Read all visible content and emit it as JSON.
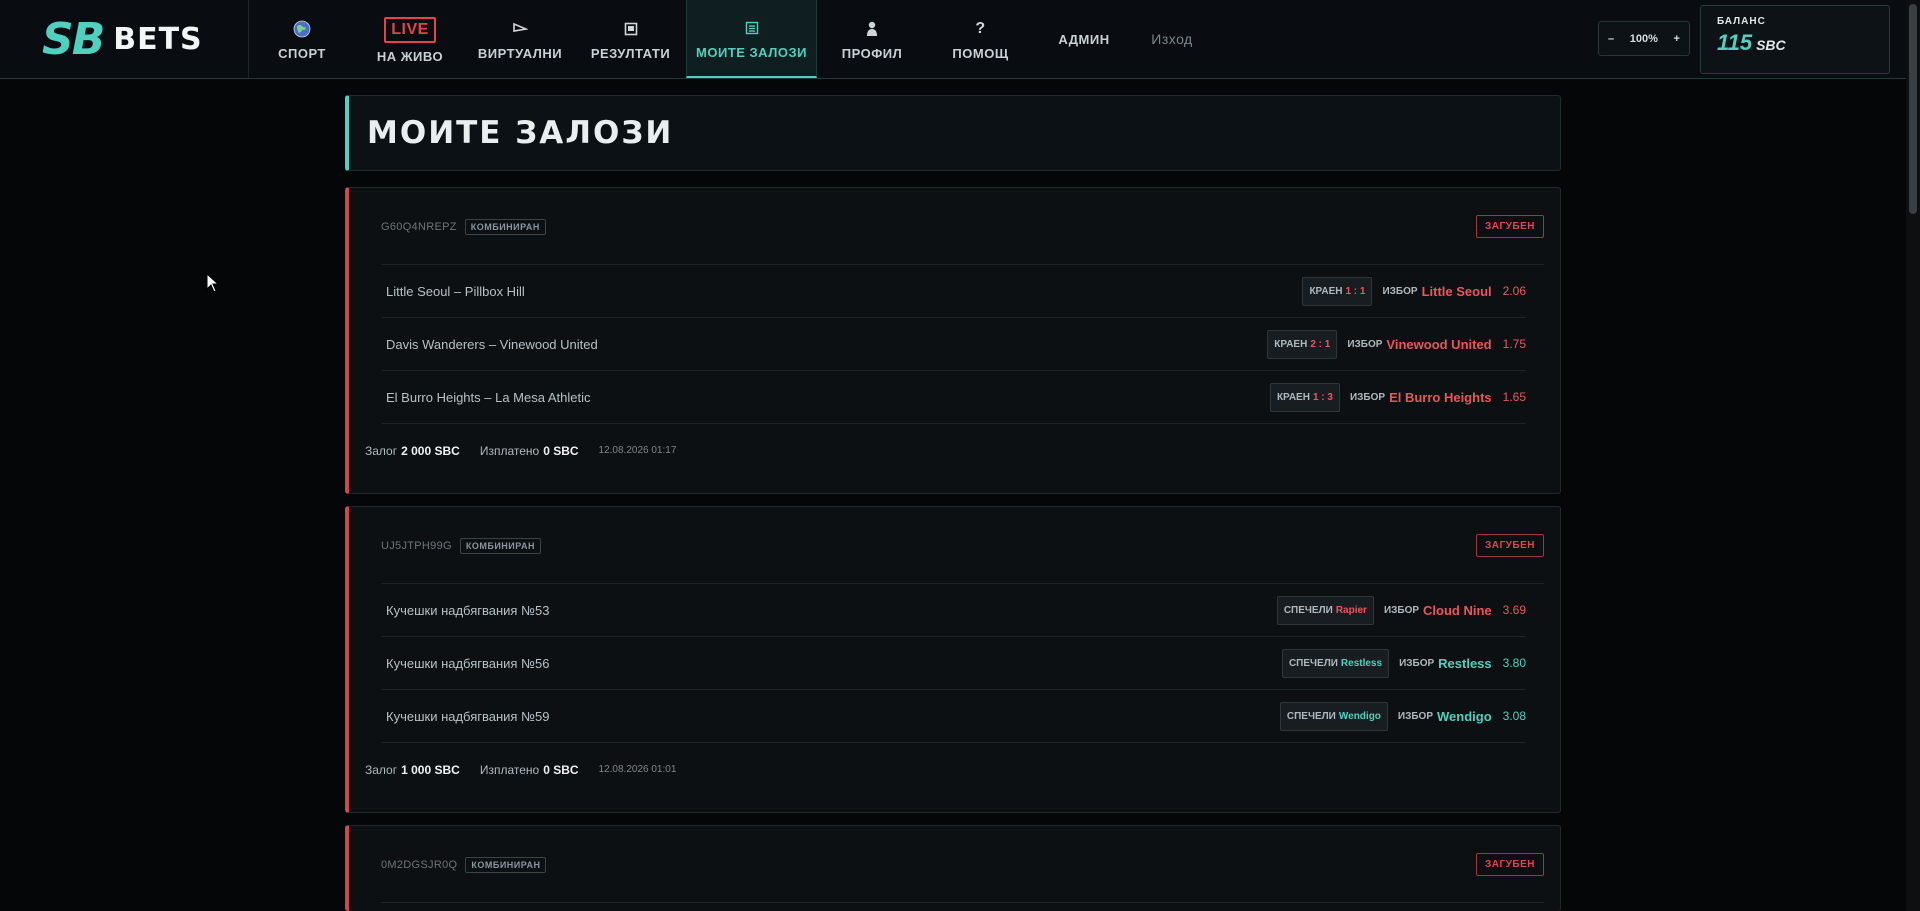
{
  "brand": {
    "sb": "SB",
    "bets": "BETS"
  },
  "nav": {
    "sport": {
      "label": "СПОРТ",
      "icon": "globe-icon"
    },
    "live": {
      "badge": "LIVE",
      "label": "НА ЖИВО"
    },
    "virtual": {
      "label": "ВИРТУАЛНИ",
      "icon": "flag-icon"
    },
    "results": {
      "label": "РЕЗУЛТАТИ",
      "icon": "results-icon"
    },
    "my_bets": {
      "label": "МОИТЕ ЗАЛОЗИ",
      "icon": "list-icon"
    },
    "profile": {
      "label": "ПРОФИЛ",
      "icon": "user-icon"
    },
    "help": {
      "label": "ПОМОЩ",
      "icon": "question-icon"
    },
    "admin": "АДМИН",
    "logout": "Изход"
  },
  "zoom": {
    "minus": "–",
    "value": "100%",
    "plus": "+"
  },
  "balance": {
    "label": "БАЛАНС",
    "value": "115",
    "currency": "SBC"
  },
  "page_title": "МОИТЕ ЗАЛОЗИ",
  "bets": [
    {
      "id": "G60Q4NREPZ",
      "type": "КОМБИНИРАН",
      "status": "ЗАГУБЕН",
      "legs": [
        {
          "event": "Little Seoul – Pillbox Hill",
          "result_label": "КРАЕН",
          "result_value": "1 : 1",
          "result_win": false,
          "pick_label": "ИЗБОР",
          "pick": "Little Seoul",
          "odds": "2.06",
          "win": false
        },
        {
          "event": "Davis Wanderers – Vinewood United",
          "result_label": "КРАЕН",
          "result_value": "2 : 1",
          "result_win": false,
          "pick_label": "ИЗБОР",
          "pick": "Vinewood United",
          "odds": "1.75",
          "win": false
        },
        {
          "event": "El Burro Heights – La Mesa Athletic",
          "result_label": "КРАЕН",
          "result_value": "1 : 3",
          "result_win": false,
          "pick_label": "ИЗБОР",
          "pick": "El Burro Heights",
          "odds": "1.65",
          "win": false
        }
      ],
      "stake_label": "Залог",
      "stake": "2 000 SBC",
      "paid_label": "Изплатено",
      "paid": "0 SBC",
      "datetime": "12.08.2026 01:17"
    },
    {
      "id": "UJ5JTPH99G",
      "type": "КОМБИНИРАН",
      "status": "ЗАГУБЕН",
      "legs": [
        {
          "event": "Кучешки надбягвания №53",
          "result_label": "СПЕЧЕЛИ",
          "result_value": "Rapier",
          "result_win": false,
          "pick_label": "ИЗБОР",
          "pick": "Cloud Nine",
          "odds": "3.69",
          "win": false
        },
        {
          "event": "Кучешки надбягвания №56",
          "result_label": "СПЕЧЕЛИ",
          "result_value": "Restless",
          "result_win": true,
          "pick_label": "ИЗБОР",
          "pick": "Restless",
          "odds": "3.80",
          "win": true
        },
        {
          "event": "Кучешки надбягвания №59",
          "result_label": "СПЕЧЕЛИ",
          "result_value": "Wendigo",
          "result_win": true,
          "pick_label": "ИЗБОР",
          "pick": "Wendigo",
          "odds": "3.08",
          "win": true
        }
      ],
      "stake_label": "Залог",
      "stake": "1 000 SBC",
      "paid_label": "Изплатено",
      "paid": "0 SBC",
      "datetime": "12.08.2026 01:01"
    },
    {
      "id": "0M2DGSJR0Q",
      "type": "КОМБИНИРАН",
      "status": "ЗАГУБЕН",
      "legs": []
    }
  ],
  "colors": {
    "accent": "#4fd1c0",
    "lost": "#e0474c",
    "background": "#040608"
  }
}
